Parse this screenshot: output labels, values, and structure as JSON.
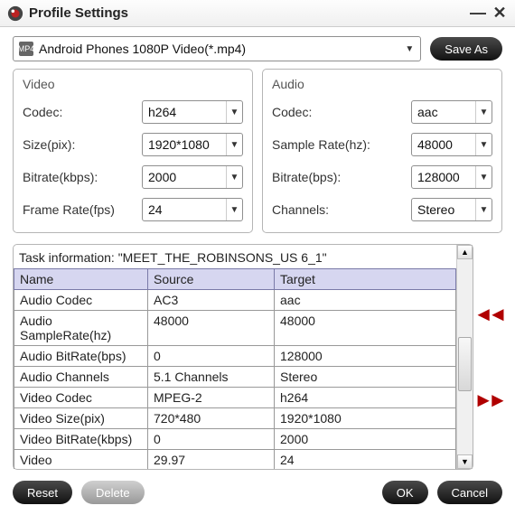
{
  "window": {
    "title": "Profile Settings"
  },
  "topbar": {
    "profile_label": "Android Phones 1080P Video(*.mp4)",
    "mp4_badge": "MP4",
    "save_as": "Save As"
  },
  "video": {
    "heading": "Video",
    "codec_label": "Codec:",
    "codec_value": "h264",
    "size_label": "Size(pix):",
    "size_value": "1920*1080",
    "bitrate_label": "Bitrate(kbps):",
    "bitrate_value": "2000",
    "framerate_label": "Frame Rate(fps)",
    "framerate_value": "24"
  },
  "audio": {
    "heading": "Audio",
    "codec_label": "Codec:",
    "codec_value": "aac",
    "samplerate_label": "Sample Rate(hz):",
    "samplerate_value": "48000",
    "bitrate_label": "Bitrate(bps):",
    "bitrate_value": "128000",
    "channels_label": "Channels:",
    "channels_value": "Stereo"
  },
  "task": {
    "title": "Task information: \"MEET_THE_ROBINSONS_US 6_1\"",
    "columns": {
      "name": "Name",
      "source": "Source",
      "target": "Target"
    },
    "rows": [
      {
        "name": "Audio Codec",
        "source": "AC3",
        "target": "aac"
      },
      {
        "name": "Audio SampleRate(hz)",
        "source": "48000",
        "target": "48000"
      },
      {
        "name": "Audio BitRate(bps)",
        "source": "0",
        "target": "128000"
      },
      {
        "name": "Audio Channels",
        "source": "5.1 Channels",
        "target": "Stereo"
      },
      {
        "name": "Video Codec",
        "source": "MPEG-2",
        "target": "h264"
      },
      {
        "name": "Video Size(pix)",
        "source": "720*480",
        "target": "1920*1080"
      },
      {
        "name": "Video BitRate(kbps)",
        "source": "0",
        "target": "2000"
      },
      {
        "name": "Video",
        "source": "29.97",
        "target": "24"
      }
    ]
  },
  "footer": {
    "reset": "Reset",
    "delete": "Delete",
    "ok": "OK",
    "cancel": "Cancel"
  },
  "icons": {
    "minimize": "—",
    "close": "✕",
    "caret": "▼",
    "prev": "◄◄",
    "next": "►►",
    "up": "▲",
    "down": "▼"
  }
}
